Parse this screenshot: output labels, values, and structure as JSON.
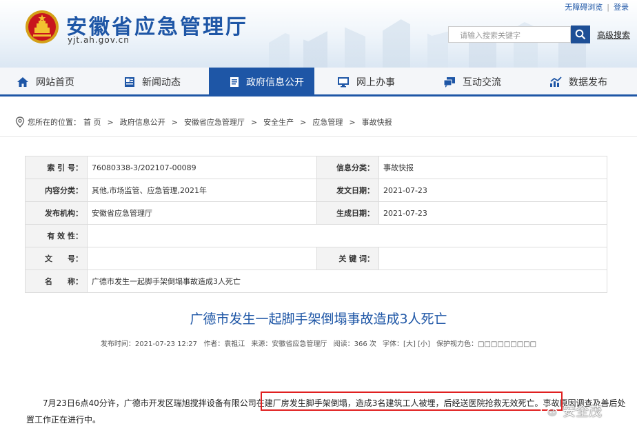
{
  "header": {
    "site_title": "安徽省应急管理厅",
    "domain": "yjt.ah.gov.cn",
    "accessibility_link": "无障碍浏览",
    "separator": "|",
    "login_link": "登录",
    "search_placeholder": "请输入搜索关键字",
    "advanced_search": "高级搜索",
    "brand_color": "#1e56a6"
  },
  "nav": {
    "items": [
      {
        "label": "网站首页",
        "icon": "home-icon"
      },
      {
        "label": "新闻动态",
        "icon": "news-icon"
      },
      {
        "label": "政府信息公开",
        "icon": "document-icon",
        "active": true
      },
      {
        "label": "网上办事",
        "icon": "monitor-icon"
      },
      {
        "label": "互动交流",
        "icon": "chat-icon"
      },
      {
        "label": "数据发布",
        "icon": "chart-icon"
      }
    ]
  },
  "breadcrumb": {
    "prefix": "您所在的位置：",
    "items": [
      "首 页",
      "政府信息公开",
      "安徽省应急管理厅",
      "安全生产",
      "应急管理",
      "事故快报"
    ],
    "arrow": ">"
  },
  "info": {
    "index_label": "索 引 号：",
    "index_value": "76080338-3/202107-00089",
    "category_label": "信息分类：",
    "category_value": "事故快报",
    "content_label": "内容分类：",
    "content_value": "其他,市场监管、应急管理,2021年",
    "pubdate_label": "发文日期：",
    "pubdate_value": "2021-07-23",
    "org_label": "发布机构：",
    "org_value": "安徽省应急管理厅",
    "gendate_label": "生成日期：",
    "gendate_value": "2021-07-23",
    "validity_label": "有 效 性：",
    "validity_value": "",
    "docno_label": "文　　号：",
    "docno_value": "",
    "keywords_label": "关 键 词：",
    "keywords_value": "",
    "name_label": "名　　称：",
    "name_value": "广德市发生一起脚手架倒塌事故造成3人死亡"
  },
  "article": {
    "title": "广德市发生一起脚手架倒塌事故造成3人死亡",
    "meta_time": "发布时间：2021-07-23 12:27",
    "meta_author": "作者：袁祖江",
    "meta_source": "来源：安徽省应急管理厅",
    "meta_views": "阅读：366 次",
    "meta_font": "字体：[大] [小]",
    "meta_eye": "保护视力色：□□□□□□□□□",
    "paragraph": "7月23日6点40分许，广德市开发区瑞旭搅拌设备有限公司在建厂房发生脚手架倒塌，造成3名建筑工人被埋，后经送医院抢救无效死亡。事故原因调查及善后处置工作正在进行中。"
  },
  "watermark": {
    "text": "安全茂",
    "icon": "wechat-icon"
  }
}
